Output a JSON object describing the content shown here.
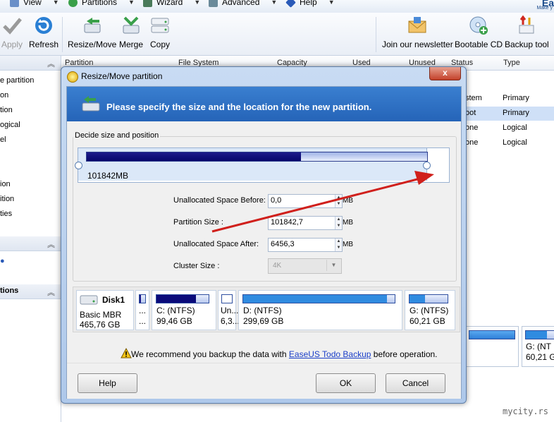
{
  "menubar": {
    "items": [
      {
        "label": "View",
        "icon": "view-icon"
      },
      {
        "label": "Partitions",
        "icon": "partitions-icon"
      },
      {
        "label": "Wizard",
        "icon": "wizard-icon"
      },
      {
        "label": "Advanced",
        "icon": "advanced-icon"
      },
      {
        "label": "Help",
        "icon": "help-icon"
      }
    ],
    "brand": "Ea",
    "brand_sub": "Make y"
  },
  "toolbar": {
    "apply": "Apply",
    "refresh": "Refresh",
    "resize_move": "Resize/Move",
    "merge": "Merge",
    "copy": "Copy",
    "newsletter": "Join our newsletter",
    "bootable_cd": "Bootable CD",
    "backup_tool": "Backup tool"
  },
  "left_panel": {
    "items_top": [
      "e partition",
      "on",
      "tion",
      "ogical",
      "el"
    ],
    "items_mid": [
      "ion",
      "ition",
      "ties"
    ],
    "section_bottom": "tions"
  },
  "grid": {
    "headers": [
      "Partition",
      "File System",
      "Capacity",
      "Used",
      "Unused",
      "Status",
      "Type"
    ],
    "rows": [
      {
        "status": "stem",
        "type": "Primary",
        "selected": false
      },
      {
        "status": "oot",
        "type": "Primary",
        "selected": true
      },
      {
        "status": "one",
        "type": "Logical",
        "selected": false
      },
      {
        "status": "one",
        "type": "Logical",
        "selected": false
      }
    ],
    "right_disk": {
      "line1": "G: (NT",
      "line2": "60,21 G"
    }
  },
  "dialog": {
    "title": "Resize/Move partition",
    "close_label": "x",
    "banner": "Please specify the size and the location for the new partition.",
    "group_label": "Decide size and position",
    "partition_size_label": "101842MB",
    "used_fraction": 0.63,
    "fields": {
      "before_label": "Unallocated Space Before:",
      "before_value": "0,0",
      "size_label": "Partition Size :",
      "size_value": "101842,7",
      "after_label": "Unallocated Space After:",
      "after_value": "6456,3",
      "cluster_label": "Cluster Size :",
      "cluster_value": "4K",
      "unit": "MB"
    },
    "disk": {
      "name": "Disk1",
      "type": "Basic MBR",
      "size": "465,76 GB",
      "partitions": [
        {
          "line1": "...",
          "line2": "...",
          "fill": 0.3,
          "color": "#1a1a8a"
        },
        {
          "line1": "C: (NTFS)",
          "line2": "99,46 GB",
          "fill": 0.75,
          "color": "#0a0a7a"
        },
        {
          "line1": "Un...",
          "line2": "6,3...",
          "fill": 0.0,
          "color": "#ffffff"
        },
        {
          "line1": "D: (NTFS)",
          "line2": "299,69 GB",
          "fill": 0.95,
          "color": "#2f8be0"
        },
        {
          "line1": "G: (NTFS)",
          "line2": "60,21 GB",
          "fill": 0.4,
          "color": "#2f8be0"
        }
      ]
    },
    "warning_prefix": "We recommend you backup the data with ",
    "warning_link": "EaseUS Todo Backup",
    "warning_suffix": " before operation.",
    "buttons": {
      "help": "Help",
      "ok": "OK",
      "cancel": "Cancel"
    }
  },
  "watermark": "mycity.rs",
  "colors": {
    "banner": "#2f6fc2",
    "annotation_arrow": "#d0201c",
    "selection": "#cfe0f7"
  }
}
